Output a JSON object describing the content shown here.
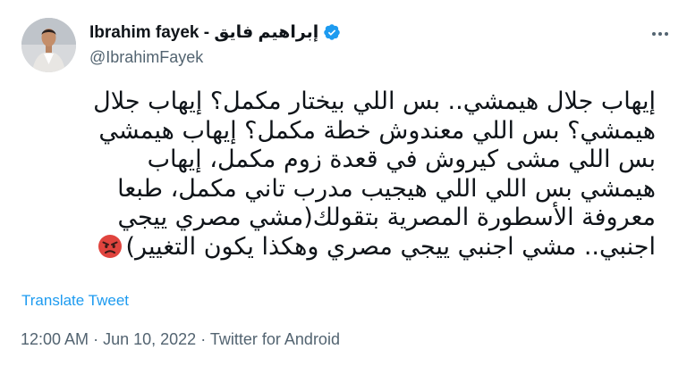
{
  "author": {
    "display_name": "Ibrahim fayek - إبراهيم فايق",
    "handle": "@IbrahimFayek",
    "verified_icon": "verified-badge-icon",
    "avatar_icon": "avatar-photo"
  },
  "tweet": {
    "lines": [
      "إيهاب جلال هيمشي.. بس اللي بيختار مكمل؟ إيهاب جلال",
      "هيمشي؟ بس اللي معندوش خطة مكمل؟ إيهاب هيمشي",
      "بس اللي مشى كيروش في قعدة زوم مكمل، إيهاب",
      "هيمشي بس اللي اللي هيجيب مدرب تاني مكمل، طبعا",
      "معروفة الأسطورة المصرية بتقولك(مشي مصري ييجي",
      "اجنبي.. مشي اجنبي ييجي مصري وهكذا يكون التغيير)"
    ],
    "emoji_icon": "angry-face-emoji-icon"
  },
  "translate_label": "Translate Tweet",
  "meta": {
    "time": "12:00 AM",
    "date": "Jun 10, 2022",
    "separator": "·",
    "source": "Twitter for Android"
  },
  "colors": {
    "link": "#1d9bf0",
    "secondary_text": "#536471",
    "primary_text": "#0f1419"
  },
  "more_icon": "more-options-icon"
}
